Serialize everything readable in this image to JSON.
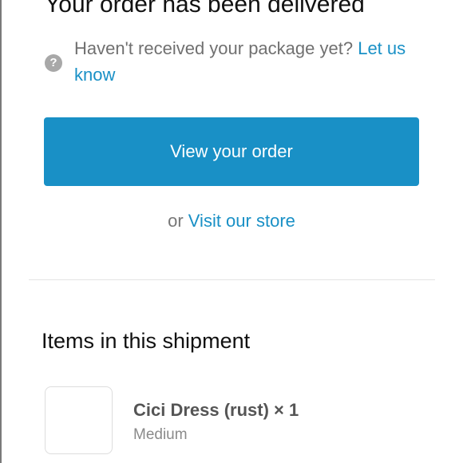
{
  "header": {
    "title": "Your order has been delivered"
  },
  "help": {
    "icon": "question-circle-icon",
    "text": "Haven't received your package yet?",
    "link_label": "Let us know"
  },
  "actions": {
    "primary_label": "View your order",
    "or_text": "or",
    "secondary_link_label": "Visit our store"
  },
  "shipment": {
    "title": "Items in this shipment",
    "items": [
      {
        "name": "Cici Dress (rust) × 1",
        "variant": "Medium"
      }
    ]
  },
  "colors": {
    "accent": "#1990c6",
    "muted_text": "#707070",
    "icon_gray": "#a8a8a8",
    "divider": "#e3e3e3"
  }
}
